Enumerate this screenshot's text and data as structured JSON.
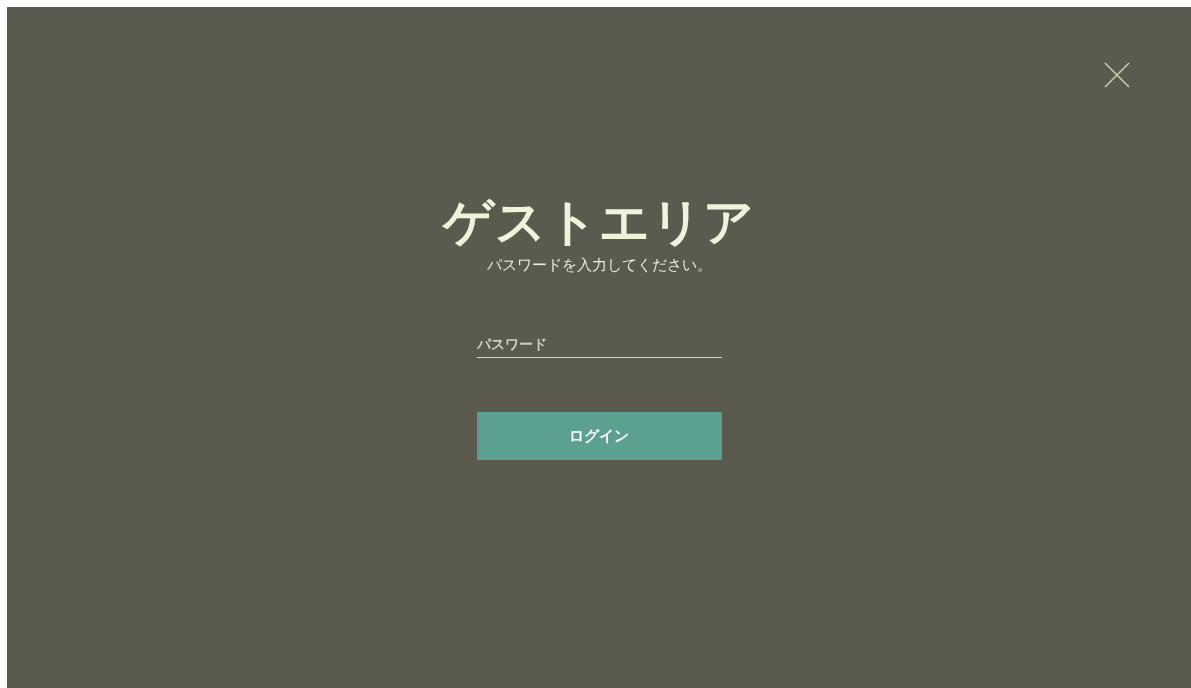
{
  "title": "ゲストエリア",
  "subtitle": "パスワードを入力してください。",
  "password_field": {
    "placeholder": "パスワード"
  },
  "button": "ログイン"
}
